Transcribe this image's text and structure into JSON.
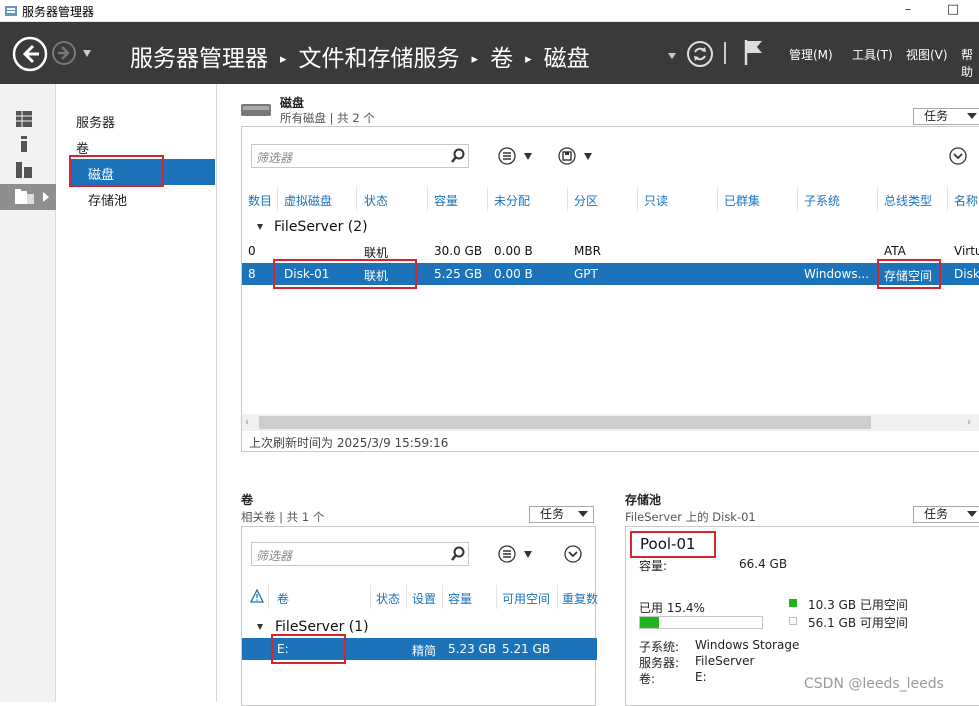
{
  "window": {
    "title": "服务器管理器",
    "minimize": "–",
    "maximize": "□"
  },
  "header": {
    "breadcrumb": [
      "服务器管理器",
      "文件和存储服务",
      "卷",
      "磁盘"
    ],
    "menu": [
      "管理(M)",
      "工具(T)",
      "视图(V)",
      "帮助"
    ]
  },
  "subnav": {
    "items": [
      "服务器",
      "卷",
      "磁盘",
      "存储池"
    ]
  },
  "disks": {
    "title": "磁盘",
    "subtitle": "所有磁盘 | 共 2 个",
    "tasks": "任务",
    "filter_placeholder": "筛选器",
    "columns": [
      "数目",
      "虚拟磁盘",
      "状态",
      "容量",
      "未分配",
      "分区",
      "只读",
      "已群集",
      "子系统",
      "总线类型",
      "名称"
    ],
    "group": "FileServer (2)",
    "rows": [
      [
        "0",
        "",
        "联机",
        "30.0 GB",
        "0.00 B",
        "MBR",
        "",
        "",
        "",
        "ATA",
        "Virtu"
      ],
      [
        "8",
        "Disk-01",
        "联机",
        "5.25 GB",
        "0.00 B",
        "GPT",
        "",
        "",
        "Windows...",
        "存储空间",
        "Disk"
      ]
    ],
    "refresh": "上次刷新时间为 2025/3/9 15:59:16"
  },
  "volumes": {
    "title": "卷",
    "subtitle": "相关卷 | 共 1 个",
    "tasks": "任务",
    "filter_placeholder": "筛选器",
    "columns": [
      "卷",
      "状态",
      "设置",
      "容量",
      "可用空间",
      "重复数"
    ],
    "group": "FileServer (1)",
    "row": [
      "E:",
      "",
      "精简",
      "5.23 GB",
      "5.21 GB"
    ]
  },
  "pool": {
    "title": "存储池",
    "subtitle": "FileServer 上的 Disk-01",
    "tasks": "任务",
    "name": "Pool-01",
    "capacity_label": "容量:",
    "capacity": "66.4 GB",
    "used_label": "已用 15.4%",
    "used_fraction": 0.154,
    "used_space": "10.3 GB 已用空间",
    "free_space": "56.1 GB 可用空间",
    "subsystem_label": "子系统:",
    "subsystem": "Windows Storage",
    "server_label": "服务器:",
    "server": "FileServer",
    "volume_label": "卷:",
    "volume": "E:",
    "accent": "#1fb51f"
  },
  "watermark": "CSDN @leeds_leeds"
}
